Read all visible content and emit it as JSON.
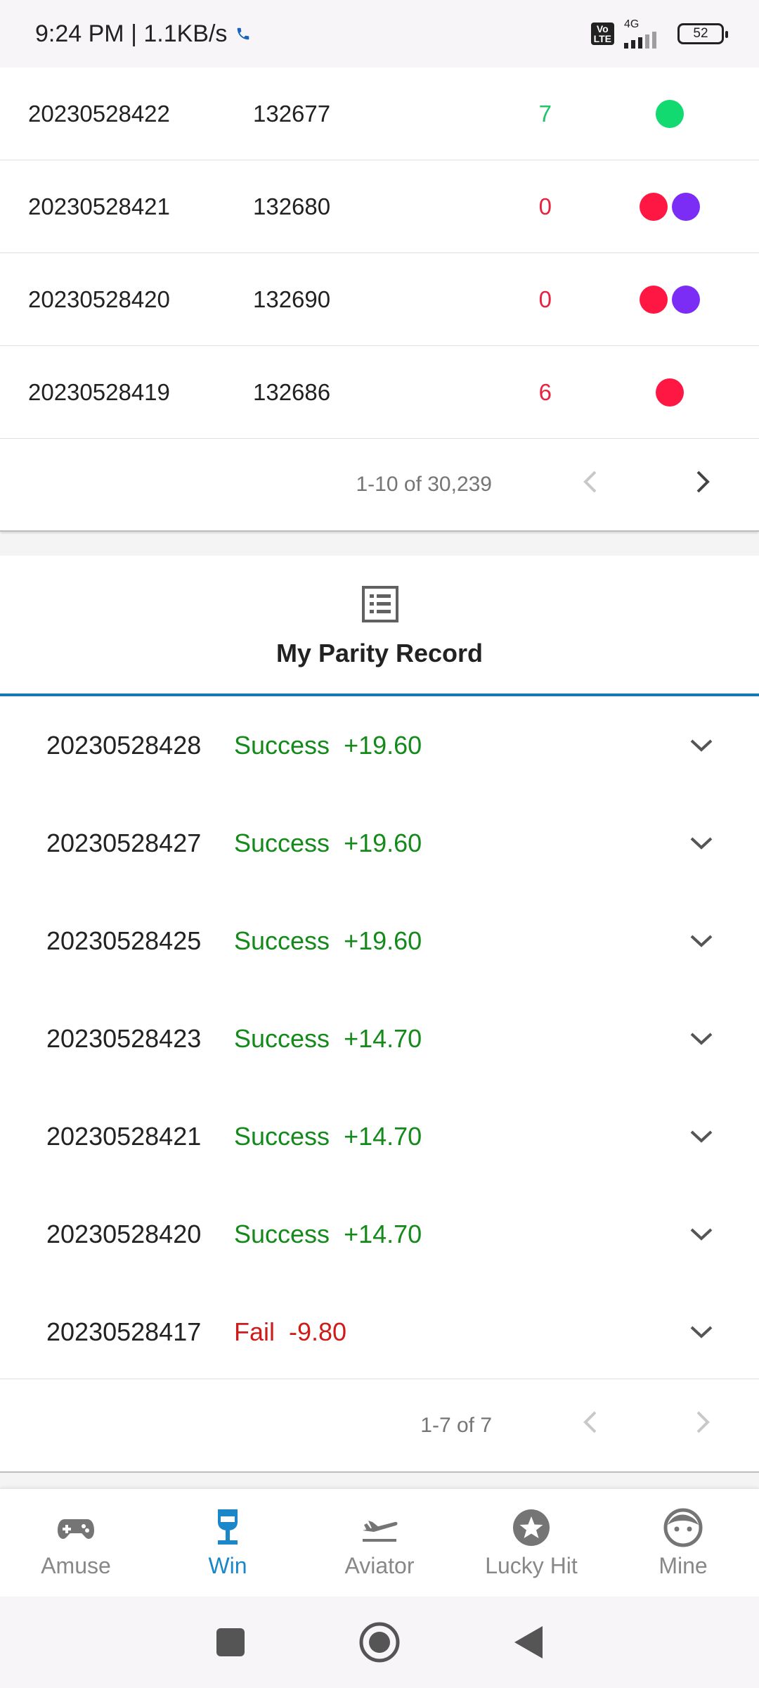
{
  "status_bar": {
    "time_speed": "9:24 PM | 1.1KB/s",
    "volte_label": "Vo LTE",
    "network_label": "4G",
    "battery_level": "52"
  },
  "results": {
    "rows": [
      {
        "period": "20230528422",
        "price": "132677",
        "number": "7",
        "number_color": "#1ec66a",
        "dots": [
          "#12d970"
        ]
      },
      {
        "period": "20230528421",
        "price": "132680",
        "number": "0",
        "number_color": "#e8213f",
        "dots": [
          "#ff1744",
          "#7b2cf5"
        ]
      },
      {
        "period": "20230528420",
        "price": "132690",
        "number": "0",
        "number_color": "#e8213f",
        "dots": [
          "#ff1744",
          "#7b2cf5"
        ]
      },
      {
        "period": "20230528419",
        "price": "132686",
        "number": "6",
        "number_color": "#e8213f",
        "dots": [
          "#ff1744"
        ]
      }
    ],
    "pager_text": "1-10 of 30,239"
  },
  "record": {
    "title": "My Parity Record",
    "items": [
      {
        "period": "20230528428",
        "status": "Success",
        "amount": "+19.60",
        "kind": "success"
      },
      {
        "period": "20230528427",
        "status": "Success",
        "amount": "+19.60",
        "kind": "success"
      },
      {
        "period": "20230528425",
        "status": "Success",
        "amount": "+19.60",
        "kind": "success"
      },
      {
        "period": "20230528423",
        "status": "Success",
        "amount": "+14.70",
        "kind": "success"
      },
      {
        "period": "20230528421",
        "status": "Success",
        "amount": "+14.70",
        "kind": "success"
      },
      {
        "period": "20230528420",
        "status": "Success",
        "amount": "+14.70",
        "kind": "success"
      },
      {
        "period": "20230528417",
        "status": "Fail",
        "amount": "-9.80",
        "kind": "fail"
      }
    ],
    "pager_text": "1-7 of 7"
  },
  "nav": {
    "items": [
      {
        "label": "Amuse",
        "icon": "gamepad-icon"
      },
      {
        "label": "Win",
        "icon": "trophy-icon",
        "active": true
      },
      {
        "label": "Aviator",
        "icon": "plane-icon"
      },
      {
        "label": "Lucky Hit",
        "icon": "star-icon"
      },
      {
        "label": "Mine",
        "icon": "face-icon"
      }
    ]
  },
  "colors": {
    "accent": "#1b87c8",
    "success": "#138a1a",
    "fail": "#d11a1a"
  }
}
